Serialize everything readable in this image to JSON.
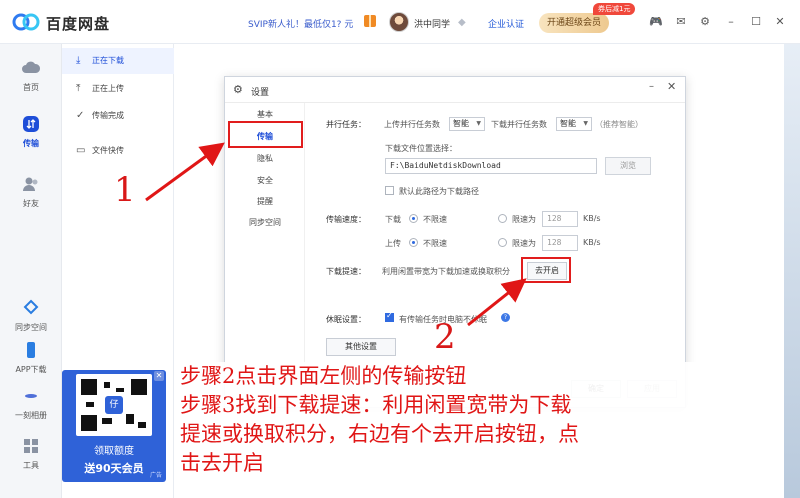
{
  "app": {
    "name": "百度网盘",
    "svip_promo": "SVIP新人礼！最低仅1? 元",
    "username": "洪中同学",
    "enterprise": "企业认证",
    "vip_button": "开通超级会员",
    "vip_badge": "券后减1元"
  },
  "left_nav": {
    "home": "首页",
    "transfer": "传输",
    "friends": "好友",
    "sync": "同步空间",
    "app_download": "APP下载",
    "photo": "一刻相册",
    "tools": "工具"
  },
  "transfer_panel": {
    "downloading": "正在下载",
    "uploading": "正在上传",
    "done": "传输完成",
    "quick_send": "文件快传"
  },
  "promo": {
    "line1": "领取额度",
    "line2": "送90天会员",
    "small": "广告"
  },
  "dialog": {
    "title": "设置",
    "side": [
      "基本",
      "传输",
      "隐私",
      "安全",
      "提醒",
      "同步空间"
    ],
    "parallel_label": "并行任务：",
    "upload_parallel_label": "上传并行任务数",
    "upload_parallel_value": "智能",
    "download_parallel_label": "下载并行任务数",
    "download_parallel_value": "智能",
    "recommend": "（推荐智能）",
    "download_location_label": "下载文件位置选择：",
    "download_path": "F:\\BaiduNetdiskDownload",
    "browse": "浏览",
    "default_path": "默认此路径为下载路径",
    "speed_label": "传输速度：",
    "download_label": "下载",
    "upload_label": "上传",
    "unlimited": "不限速",
    "limit_to": "限速为",
    "download_limit": "128",
    "upload_limit": "128",
    "unit": "KB/s",
    "boost_label": "下载提速：",
    "boost_desc": "利用闲置带宽为下载加速或换取积分",
    "boost_button": "去开启",
    "sleep_label": "休眠设置：",
    "sleep_desc": "有传输任务时电脑不休眠",
    "other_settings": "其他设置",
    "ok": "确定",
    "apply": "应用"
  },
  "annotations": {
    "num1": "1",
    "num2": "2",
    "line1": "步骤2点击界面左侧的传输按钮",
    "line2": "步骤3找到下载提速：利用闲置宽带为下载",
    "line3": "提速或换取积分，右边有个去开启按钮，点",
    "line4": "击去开启"
  },
  "colors": {
    "accent": "#1e4ed8",
    "annotation": "#e01616"
  }
}
